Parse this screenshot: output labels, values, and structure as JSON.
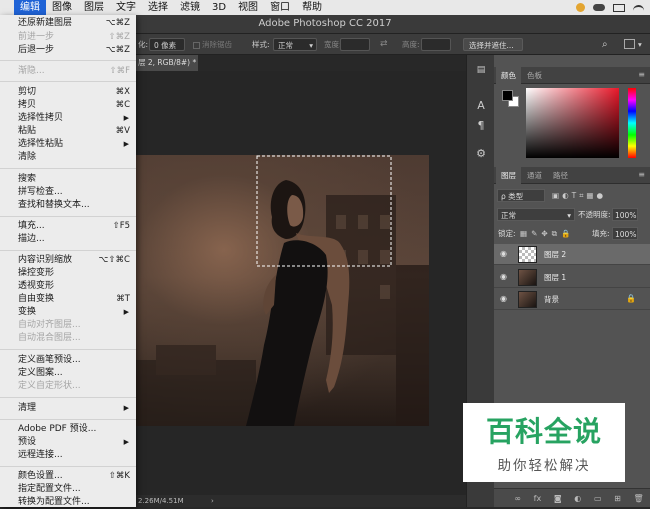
{
  "menubar": {
    "apple": "",
    "items": [
      "编辑",
      "图像",
      "图层",
      "文字",
      "选择",
      "滤镜",
      "3D",
      "视图",
      "窗口",
      "帮助"
    ],
    "active_index": 0
  },
  "titlebar": {
    "title": "Adobe Photoshop CC 2017"
  },
  "options_bar": {
    "feather_label": "化:",
    "feather_value": "0 像素",
    "antialias": "消除锯齿",
    "style_label": "样式:",
    "style_value": "正常",
    "width_label": "宽度:",
    "height_label": "高度:",
    "select_mask_button": "选择并遮住..."
  },
  "document": {
    "tab_label": "层 2, RGB/8#) *",
    "status": "2.26M/4.51M"
  },
  "edit_menu": {
    "rows": [
      {
        "label": "还原新建图层",
        "shortcut": "⌥⌘Z",
        "disabled": false
      },
      {
        "label": "前进一步",
        "shortcut": "⇧⌘Z",
        "disabled": true
      },
      {
        "label": "后退一步",
        "shortcut": "⌥⌘Z",
        "disabled": false
      },
      {
        "label": "渐隐...",
        "shortcut": "⇧⌘F",
        "disabled": true
      },
      {
        "label": "剪切",
        "shortcut": "⌘X",
        "disabled": false
      },
      {
        "label": "拷贝",
        "shortcut": "⌘C",
        "disabled": false
      },
      {
        "label": "选择性拷贝",
        "shortcut": "▶",
        "disabled": false
      },
      {
        "label": "粘贴",
        "shortcut": "⌘V",
        "disabled": false
      },
      {
        "label": "选择性粘贴",
        "shortcut": "▶",
        "disabled": false
      },
      {
        "label": "清除",
        "shortcut": "",
        "disabled": false
      },
      {
        "label": "搜索",
        "shortcut": "",
        "disabled": false
      },
      {
        "label": "拼写检查...",
        "shortcut": "",
        "disabled": false
      },
      {
        "label": "查找和替换文本...",
        "shortcut": "",
        "disabled": false
      },
      {
        "label": "填充...",
        "shortcut": "⇧F5",
        "disabled": false
      },
      {
        "label": "描边...",
        "shortcut": "",
        "disabled": false
      },
      {
        "label": "内容识别缩放",
        "shortcut": "⌥⇧⌘C",
        "disabled": false
      },
      {
        "label": "操控变形",
        "shortcut": "",
        "disabled": false
      },
      {
        "label": "透视变形",
        "shortcut": "",
        "disabled": false
      },
      {
        "label": "自由变换",
        "shortcut": "⌘T",
        "disabled": false
      },
      {
        "label": "变换",
        "shortcut": "▶",
        "disabled": false
      },
      {
        "label": "自动对齐图层...",
        "shortcut": "",
        "disabled": true
      },
      {
        "label": "自动混合图层...",
        "shortcut": "",
        "disabled": true
      },
      {
        "label": "定义画笔预设...",
        "shortcut": "",
        "disabled": false
      },
      {
        "label": "定义图案...",
        "shortcut": "",
        "disabled": false
      },
      {
        "label": "定义自定形状...",
        "shortcut": "",
        "disabled": true
      },
      {
        "label": "清理",
        "shortcut": "▶",
        "disabled": false
      },
      {
        "label": "Adobe PDF 预设...",
        "shortcut": "",
        "disabled": false
      },
      {
        "label": "预设",
        "shortcut": "▶",
        "disabled": false
      },
      {
        "label": "远程连接...",
        "shortcut": "",
        "disabled": false
      },
      {
        "label": "颜色设置...",
        "shortcut": "⇧⌘K",
        "disabled": false
      },
      {
        "label": "指定配置文件...",
        "shortcut": "",
        "disabled": false
      },
      {
        "label": "转换为配置文件...",
        "shortcut": "",
        "disabled": false
      }
    ]
  },
  "color_panel": {
    "tabs": [
      "颜色",
      "色板"
    ],
    "foreground": "#000000",
    "background": "#ffffff"
  },
  "layers_panel": {
    "tabs": [
      "图层",
      "通道",
      "路径"
    ],
    "filter_label": "ρ 类型",
    "blend_mode": "正常",
    "opacity_label": "不透明度:",
    "opacity_value": "100%",
    "lock_label": "锁定:",
    "fill_label": "填充:",
    "fill_value": "100%",
    "layers": [
      {
        "name": "图层 2",
        "selected": true
      },
      {
        "name": "图层 1",
        "selected": false
      },
      {
        "name": "背景",
        "selected": false
      }
    ]
  },
  "watermark": {
    "title": "百科全说",
    "subtitle": "助你轻松解决"
  },
  "colors": {
    "menu_highlight": "#1f63d6",
    "watermark_green": "#27a361"
  }
}
